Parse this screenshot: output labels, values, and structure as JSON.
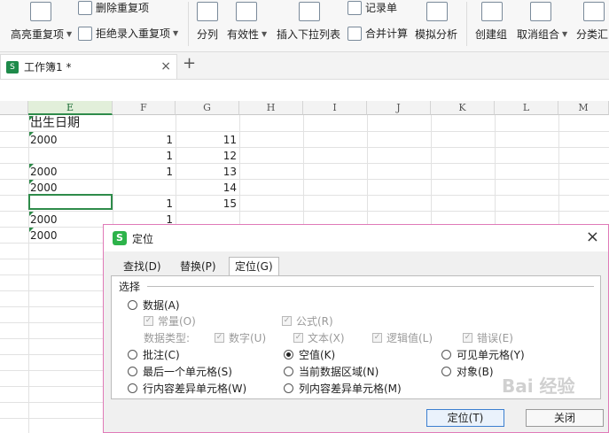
{
  "ribbon": {
    "highlight_dup": "高亮重复项",
    "delete_dup": "删除重复项",
    "reject_dup": "拒绝录入重复项",
    "split": "分列",
    "validity": "有效性",
    "insert_dropdown": "插入下拉列表",
    "record_list": "记录单",
    "merge_calc": "合并计算",
    "simulate": "模拟分析",
    "create_group": "创建组",
    "ungroup": "取消组合",
    "subtotal": "分类汇"
  },
  "tabs": {
    "workbook": "工作簿1 *",
    "close": "×",
    "add": "+"
  },
  "columns": [
    "E",
    "F",
    "G",
    "H",
    "I",
    "J",
    "K",
    "L",
    "M"
  ],
  "cells": {
    "e_header": "出生日期",
    "e_r1": "2000",
    "f_r1": "1",
    "g_r1": "11",
    "f_r2": "1",
    "g_r2": "12",
    "e_r3": "2000",
    "f_r3": "1",
    "g_r3": "13",
    "e_r4": "2000",
    "g_r4": "14",
    "f_r5": "1",
    "g_r5": "15",
    "e_r6": "2000",
    "f_r6": "1",
    "e_r7": "2000"
  },
  "dialog": {
    "title": "定位",
    "close": "×",
    "tab_find": "查找(D)",
    "tab_replace": "替换(P)",
    "tab_goto": "定位(G)",
    "section": "选择",
    "opt_data": "数据(A)",
    "chk_const": "常量(O)",
    "chk_formula": "公式(R)",
    "data_types": "数据类型:",
    "chk_number": "数字(U)",
    "chk_text": "文本(X)",
    "chk_logic": "逻辑值(L)",
    "chk_error": "错误(E)",
    "opt_comment": "批注(C)",
    "opt_blank": "空值(K)",
    "opt_visible": "可见单元格(Y)",
    "opt_last": "最后一个单元格(S)",
    "opt_region": "当前数据区域(N)",
    "opt_object": "对象(B)",
    "opt_rowdiff": "行内容差异单元格(W)",
    "opt_coldiff": "列内容差异单元格(M)",
    "btn_goto": "定位(T)",
    "btn_close": "关闭",
    "watermark": "Bai 经验"
  }
}
